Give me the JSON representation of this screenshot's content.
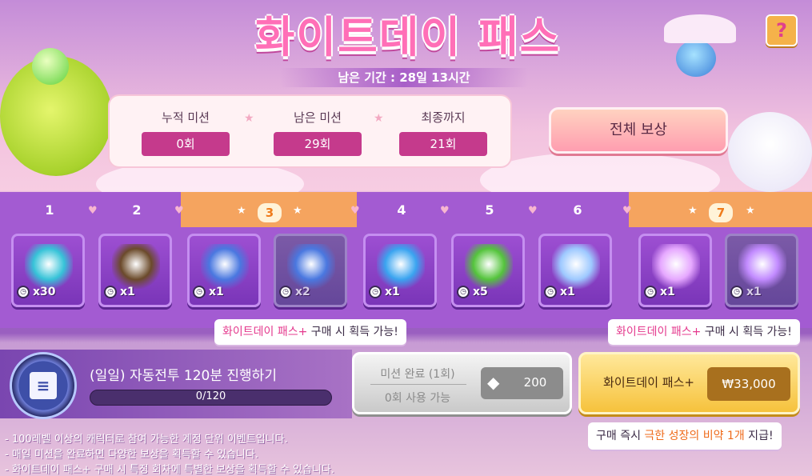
{
  "header": {
    "title": "화이트데이 패스",
    "period": "남은 기간 : 28일 13시간",
    "help_label": "?"
  },
  "stats": [
    {
      "label": "누적 미션",
      "value": "0회"
    },
    {
      "label": "남은 미션",
      "value": "29회"
    },
    {
      "label": "최종까지",
      "value": "21회"
    }
  ],
  "all_reward_label": "전체 보상",
  "levels": [
    "1",
    "2",
    "3",
    "4",
    "5",
    "6",
    "7"
  ],
  "items": [
    {
      "name": "teal-stone-item",
      "qty": "x30",
      "color": "#36c3d8",
      "locked": false
    },
    {
      "name": "pouch-item",
      "qty": "x1",
      "color": "#6b4a2a",
      "locked": false
    },
    {
      "name": "blue-ticket-item",
      "qty": "x1",
      "color": "#4a78e0",
      "locked": false
    },
    {
      "name": "blue-ticket-plus-item",
      "qty": "x2",
      "color": "#4a78e0",
      "locked": true
    },
    {
      "name": "sword-1h-item",
      "qty": "x1",
      "color": "#3aa4f0",
      "locked": false
    },
    {
      "name": "exp-item",
      "qty": "x5",
      "color": "#54c43c",
      "locked": false
    },
    {
      "name": "mystery-orb-item",
      "qty": "x1",
      "color": "#9ec9ff",
      "locked": false
    },
    {
      "name": "golden-scepter-item",
      "qty": "x1",
      "color": "#e6a8ff",
      "locked": false
    },
    {
      "name": "scepter-plus-item",
      "qty": "x1",
      "color": "#c28bff",
      "locked": true
    }
  ],
  "tips": {
    "pass_highlight": "화이트데이 패스+",
    "pass_suffix": " 구매 시 획득 가능!"
  },
  "mission": {
    "title": "(일일) 자동전투 120분 진행하기",
    "progress_text": "0/120",
    "progress": 0
  },
  "complete_btn": {
    "line1": "미션 완료 (1회)",
    "line2": "0회 사용 가능",
    "reward_amount": "200"
  },
  "buy_btn": {
    "label": "화이트데이 패스+",
    "price": "₩33,000"
  },
  "bonus_tip": {
    "prefix": "구매 즉시 ",
    "highlight": "극한 성장의 비약 1개",
    "suffix": " 지급!"
  },
  "notes": [
    "- 100레벨 이상의 캐릭터로 참여 가능한 계정 단위 이벤트입니다.",
    "- 매일 미션을 완료하면 다양한 보상을 획득할 수 있습니다.",
    "- 화이트데이 패스+ 구매 시 특정 회차에 특별한 보상을 획득할 수 있습니다."
  ],
  "colors": {
    "accent_pink": "#e4388d",
    "stat_badge": "#c53a8c",
    "premium_lane": "#f5a45f",
    "free_lane": "#a35bd2"
  }
}
